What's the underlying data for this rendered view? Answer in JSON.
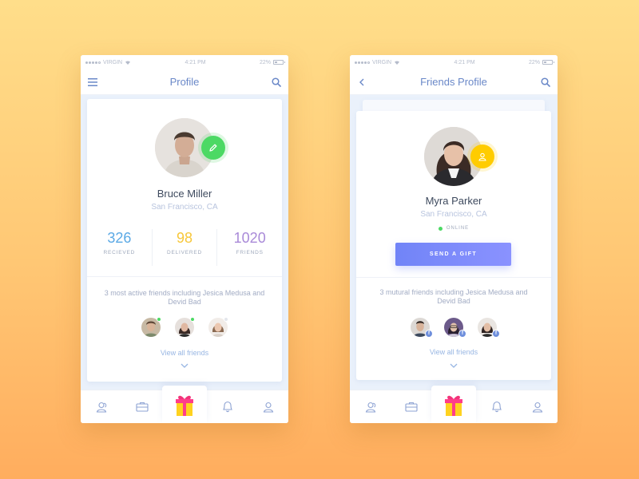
{
  "status": {
    "carrier": "VIRGIN",
    "time": "4:21 PM",
    "battery": "22%"
  },
  "profile_screen": {
    "title": "Profile",
    "user": {
      "name": "Bruce Miller",
      "location": "San Francisco, CA"
    },
    "stats": [
      {
        "value": "326",
        "label": "RECIEVED",
        "color": "#5ba9e5"
      },
      {
        "value": "98",
        "label": "DELIVERED",
        "color": "#f7c73a"
      },
      {
        "value": "1020",
        "label": "FRIENDS",
        "color": "#a98ad8"
      }
    ],
    "friends_text": "3 most active friends including Jesica Medusa and Devid Bad",
    "view_all": "View all friends"
  },
  "friends_screen": {
    "title": "Friends Profile",
    "user": {
      "name": "Myra Parker",
      "location": "San Francisco, CA",
      "status": "ONLINE"
    },
    "gift_button": "SEND A GIFT",
    "friends_text": "3 mutural friends including Jesica Medusa and Devid Bad",
    "view_all": "View all friends"
  },
  "tabbar": [
    "friends-icon",
    "briefcase-icon",
    "gift-icon",
    "bell-icon",
    "user-icon"
  ],
  "colors": {
    "accent": "#6a88c8",
    "online": "#4cd964",
    "edit_badge": "#4cd964",
    "user_badge": "#ffcc00",
    "gift_button": "#7184f7"
  }
}
